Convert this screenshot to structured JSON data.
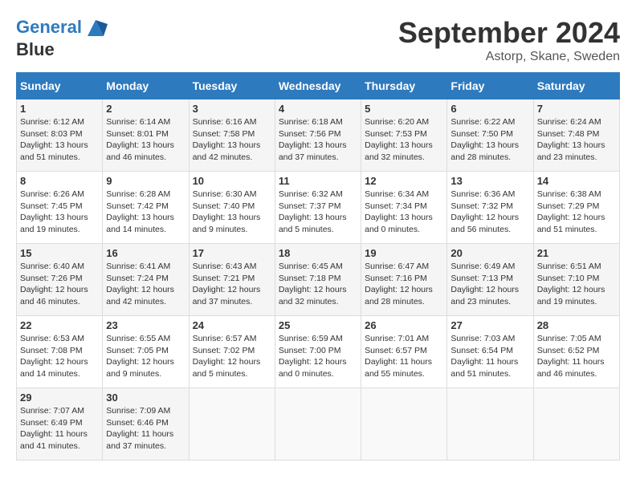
{
  "header": {
    "logo_line1": "General",
    "logo_line2": "Blue",
    "month": "September 2024",
    "location": "Astorp, Skane, Sweden"
  },
  "weekdays": [
    "Sunday",
    "Monday",
    "Tuesday",
    "Wednesday",
    "Thursday",
    "Friday",
    "Saturday"
  ],
  "weeks": [
    [
      {
        "day": "1",
        "info": "Sunrise: 6:12 AM\nSunset: 8:03 PM\nDaylight: 13 hours and 51 minutes."
      },
      {
        "day": "2",
        "info": "Sunrise: 6:14 AM\nSunset: 8:01 PM\nDaylight: 13 hours and 46 minutes."
      },
      {
        "day": "3",
        "info": "Sunrise: 6:16 AM\nSunset: 7:58 PM\nDaylight: 13 hours and 42 minutes."
      },
      {
        "day": "4",
        "info": "Sunrise: 6:18 AM\nSunset: 7:56 PM\nDaylight: 13 hours and 37 minutes."
      },
      {
        "day": "5",
        "info": "Sunrise: 6:20 AM\nSunset: 7:53 PM\nDaylight: 13 hours and 32 minutes."
      },
      {
        "day": "6",
        "info": "Sunrise: 6:22 AM\nSunset: 7:50 PM\nDaylight: 13 hours and 28 minutes."
      },
      {
        "day": "7",
        "info": "Sunrise: 6:24 AM\nSunset: 7:48 PM\nDaylight: 13 hours and 23 minutes."
      }
    ],
    [
      {
        "day": "8",
        "info": "Sunrise: 6:26 AM\nSunset: 7:45 PM\nDaylight: 13 hours and 19 minutes."
      },
      {
        "day": "9",
        "info": "Sunrise: 6:28 AM\nSunset: 7:42 PM\nDaylight: 13 hours and 14 minutes."
      },
      {
        "day": "10",
        "info": "Sunrise: 6:30 AM\nSunset: 7:40 PM\nDaylight: 13 hours and 9 minutes."
      },
      {
        "day": "11",
        "info": "Sunrise: 6:32 AM\nSunset: 7:37 PM\nDaylight: 13 hours and 5 minutes."
      },
      {
        "day": "12",
        "info": "Sunrise: 6:34 AM\nSunset: 7:34 PM\nDaylight: 13 hours and 0 minutes."
      },
      {
        "day": "13",
        "info": "Sunrise: 6:36 AM\nSunset: 7:32 PM\nDaylight: 12 hours and 56 minutes."
      },
      {
        "day": "14",
        "info": "Sunrise: 6:38 AM\nSunset: 7:29 PM\nDaylight: 12 hours and 51 minutes."
      }
    ],
    [
      {
        "day": "15",
        "info": "Sunrise: 6:40 AM\nSunset: 7:26 PM\nDaylight: 12 hours and 46 minutes."
      },
      {
        "day": "16",
        "info": "Sunrise: 6:41 AM\nSunset: 7:24 PM\nDaylight: 12 hours and 42 minutes."
      },
      {
        "day": "17",
        "info": "Sunrise: 6:43 AM\nSunset: 7:21 PM\nDaylight: 12 hours and 37 minutes."
      },
      {
        "day": "18",
        "info": "Sunrise: 6:45 AM\nSunset: 7:18 PM\nDaylight: 12 hours and 32 minutes."
      },
      {
        "day": "19",
        "info": "Sunrise: 6:47 AM\nSunset: 7:16 PM\nDaylight: 12 hours and 28 minutes."
      },
      {
        "day": "20",
        "info": "Sunrise: 6:49 AM\nSunset: 7:13 PM\nDaylight: 12 hours and 23 minutes."
      },
      {
        "day": "21",
        "info": "Sunrise: 6:51 AM\nSunset: 7:10 PM\nDaylight: 12 hours and 19 minutes."
      }
    ],
    [
      {
        "day": "22",
        "info": "Sunrise: 6:53 AM\nSunset: 7:08 PM\nDaylight: 12 hours and 14 minutes."
      },
      {
        "day": "23",
        "info": "Sunrise: 6:55 AM\nSunset: 7:05 PM\nDaylight: 12 hours and 9 minutes."
      },
      {
        "day": "24",
        "info": "Sunrise: 6:57 AM\nSunset: 7:02 PM\nDaylight: 12 hours and 5 minutes."
      },
      {
        "day": "25",
        "info": "Sunrise: 6:59 AM\nSunset: 7:00 PM\nDaylight: 12 hours and 0 minutes."
      },
      {
        "day": "26",
        "info": "Sunrise: 7:01 AM\nSunset: 6:57 PM\nDaylight: 11 hours and 55 minutes."
      },
      {
        "day": "27",
        "info": "Sunrise: 7:03 AM\nSunset: 6:54 PM\nDaylight: 11 hours and 51 minutes."
      },
      {
        "day": "28",
        "info": "Sunrise: 7:05 AM\nSunset: 6:52 PM\nDaylight: 11 hours and 46 minutes."
      }
    ],
    [
      {
        "day": "29",
        "info": "Sunrise: 7:07 AM\nSunset: 6:49 PM\nDaylight: 11 hours and 41 minutes."
      },
      {
        "day": "30",
        "info": "Sunrise: 7:09 AM\nSunset: 6:46 PM\nDaylight: 11 hours and 37 minutes."
      },
      null,
      null,
      null,
      null,
      null
    ]
  ]
}
